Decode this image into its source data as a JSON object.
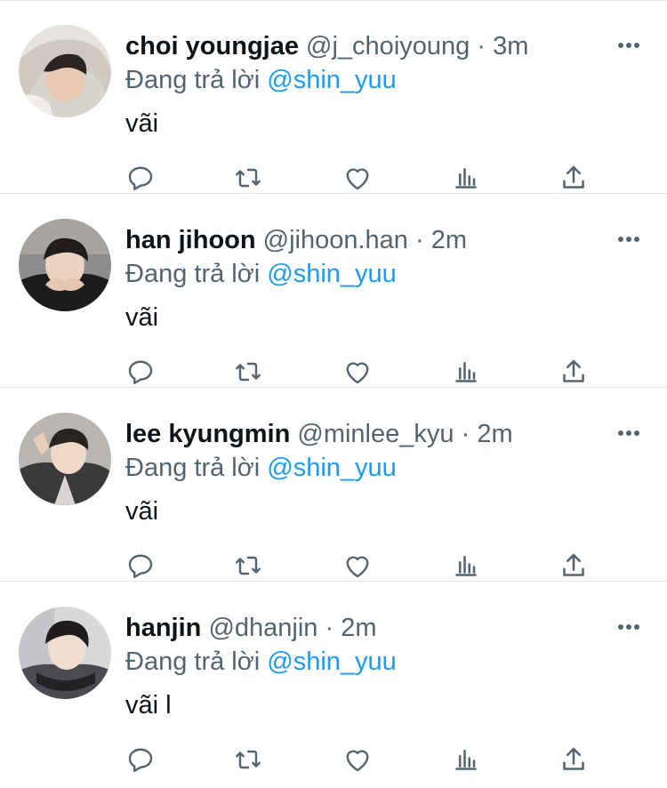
{
  "tweets": [
    {
      "name": "choi youngjae",
      "handle": "@j_choiyoung",
      "separator": "·",
      "time": "3m",
      "reply_prefix": "Đang trả lời",
      "reply_mention": "@shin_yuu",
      "text": "vãi"
    },
    {
      "name": "han jihoon",
      "handle": "@jihoon.han",
      "separator": "·",
      "time": "2m",
      "reply_prefix": "Đang trả lời",
      "reply_mention": "@shin_yuu",
      "text": "vãi"
    },
    {
      "name": "lee kyungmin",
      "handle": "@minlee_kyu",
      "separator": "·",
      "time": "2m",
      "reply_prefix": "Đang trả lời",
      "reply_mention": "@shin_yuu",
      "text": "vãi"
    },
    {
      "name": "hanjin",
      "handle": "@dhanjin",
      "separator": "·",
      "time": "2m",
      "reply_prefix": "Đang trả lời",
      "reply_mention": "@shin_yuu",
      "text": "vãi l"
    }
  ],
  "actions": [
    "reply-icon",
    "retweet-icon",
    "like-icon",
    "views-icon",
    "share-icon"
  ],
  "icons": {
    "more": "more-horizontal-icon"
  },
  "colors": {
    "icon": "#536471",
    "mention": "#1d9bf0",
    "name": "#0f1419",
    "divider": "#e1e6ea"
  }
}
